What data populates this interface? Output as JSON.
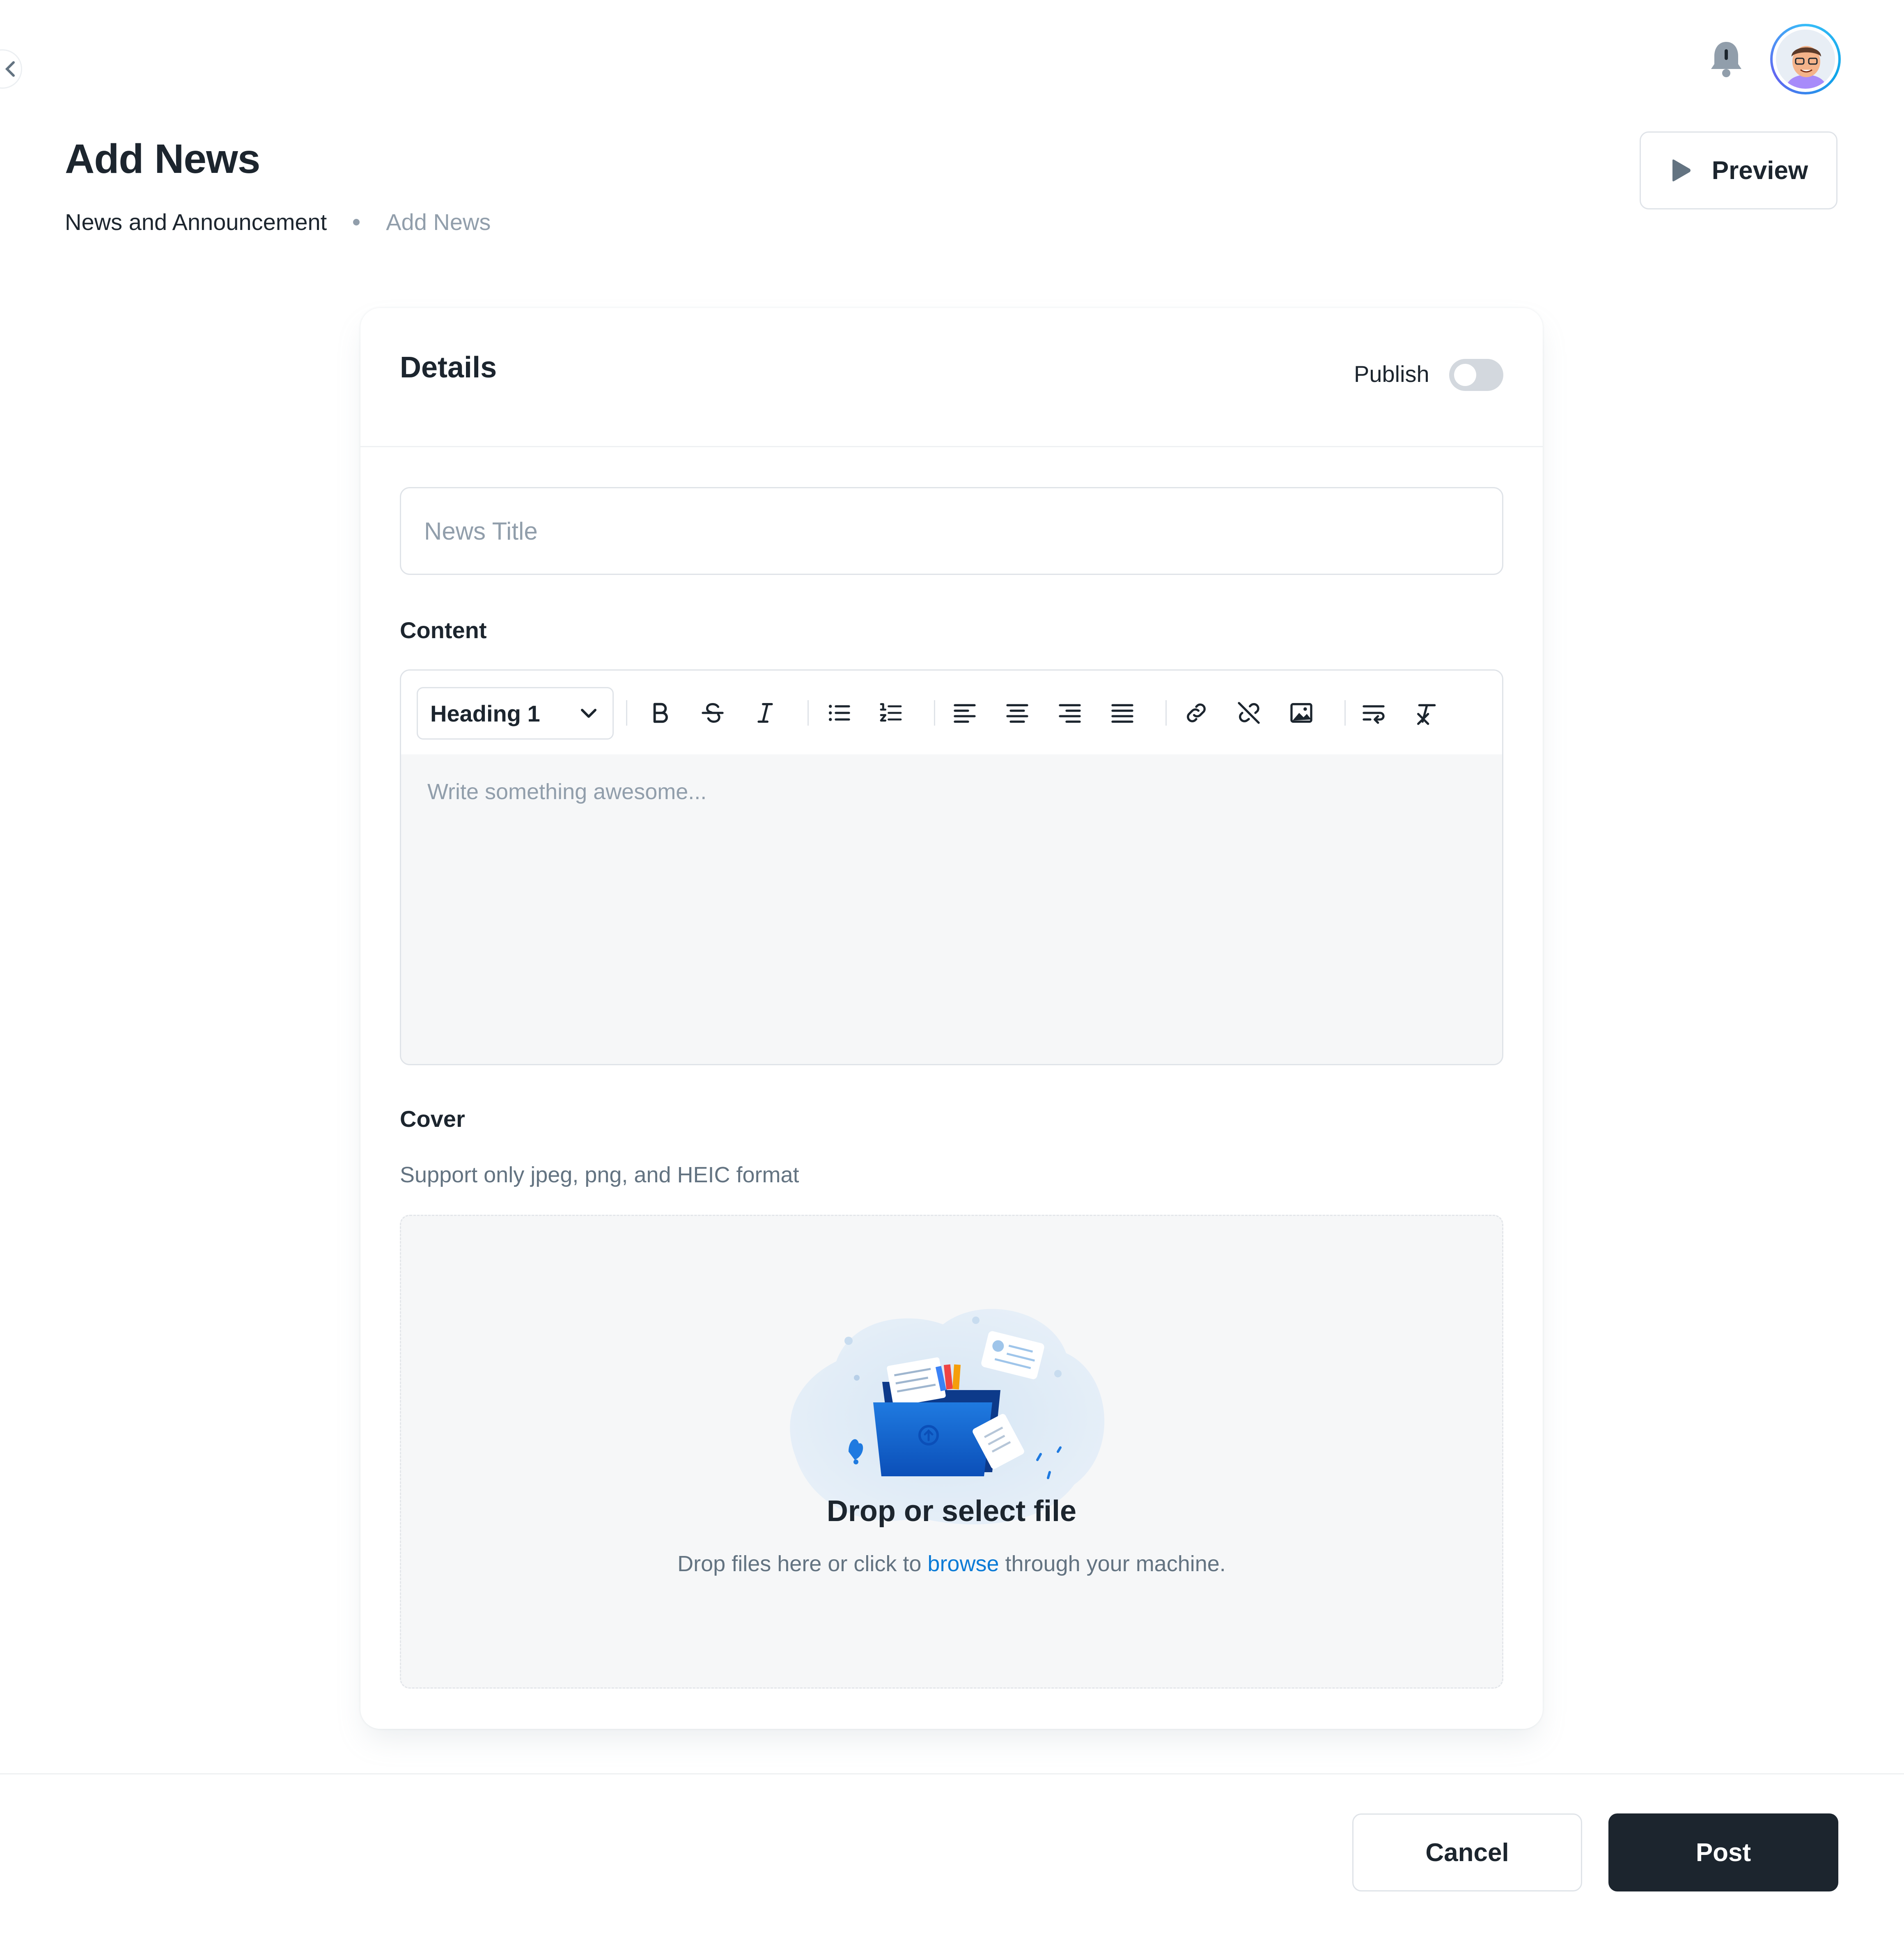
{
  "header": {
    "title": "Add News",
    "breadcrumb": [
      "News and Announcement",
      "Add News"
    ],
    "preview_label": "Preview"
  },
  "card": {
    "title": "Details",
    "publish_label": "Publish",
    "publish_enabled": false,
    "title_placeholder": "News Title",
    "content_label": "Content",
    "heading_select": "Heading 1",
    "editor_placeholder": "Write something awesome...",
    "toolbar_icons": [
      "bold-icon",
      "strikethrough-icon",
      "italic-icon",
      "bullet-list-icon",
      "numbered-list-icon",
      "align-left-icon",
      "align-center-icon",
      "align-right-icon",
      "align-justify-icon",
      "link-icon",
      "unlink-icon",
      "image-icon",
      "text-wrap-icon",
      "clear-format-icon"
    ],
    "cover_label": "Cover",
    "cover_hint": "Support only jpeg, png, and HEIC format",
    "drop_title": "Drop or select file",
    "drop_desc_before": "Drop files here or click to",
    "drop_desc_link": "browse",
    "drop_desc_after": "through your machine."
  },
  "footer": {
    "cancel_label": "Cancel",
    "post_label": "Post"
  },
  "colors": {
    "primary_dark": "#1C252E",
    "link": "#0C7BD6",
    "muted": "#919EAB",
    "border": "#DFE3E8"
  }
}
